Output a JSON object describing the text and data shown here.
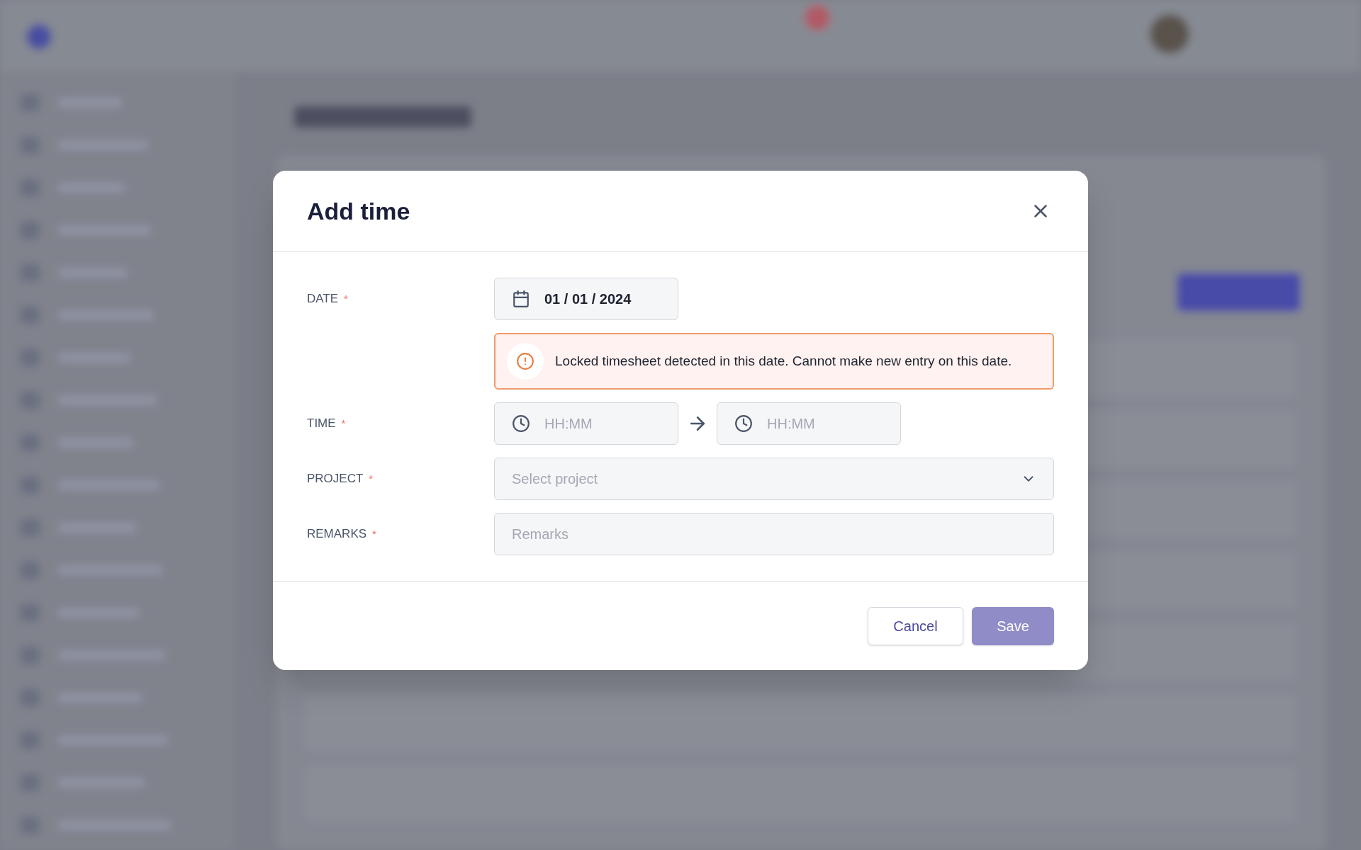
{
  "dialog": {
    "title": "Add time",
    "fields": [
      {
        "kind": "date",
        "label": "DATE",
        "mark": "*",
        "value": "01 / 01 / 2024",
        "alert": "Locked timesheet detected in this date. Cannot make new entry on this date."
      },
      {
        "kind": "time",
        "label": "TIME",
        "mark": "*",
        "start_placeholder": "HH:MM",
        "end_placeholder": "HH:MM"
      },
      {
        "kind": "select",
        "label": "PROJECT",
        "mark": "*",
        "placeholder": "Select project"
      },
      {
        "kind": "text",
        "label": "REMARKS",
        "mark": "*",
        "placeholder": "Remarks"
      }
    ],
    "buttons": [
      {
        "kind": "secondary",
        "label": "Cancel",
        "disabled": false
      },
      {
        "kind": "primary",
        "label": "Save",
        "disabled": true
      }
    ]
  }
}
